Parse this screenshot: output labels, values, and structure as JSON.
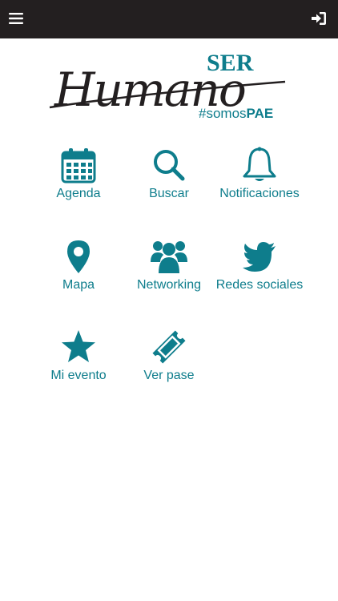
{
  "colors": {
    "topbar": "#231f20",
    "accent": "#0e7d8c",
    "logo_dark": "#231f20"
  },
  "header": {
    "menu_icon": "hamburger-icon",
    "login_icon": "sign-in-icon"
  },
  "logo": {
    "top_word": "SER",
    "script_word": "Humano",
    "hashtag_prefix": "#somos",
    "hashtag_suffix": "PAE"
  },
  "menu": {
    "items": [
      {
        "label": "Agenda",
        "icon": "calendar-icon"
      },
      {
        "label": "Buscar",
        "icon": "search-icon"
      },
      {
        "label": "Notificaciones",
        "icon": "bell-icon"
      },
      {
        "label": "Mapa",
        "icon": "map-marker-icon"
      },
      {
        "label": "Networking",
        "icon": "users-icon"
      },
      {
        "label": "Redes sociales",
        "icon": "twitter-icon"
      },
      {
        "label": "Mi evento",
        "icon": "star-icon"
      },
      {
        "label": "Ver pase",
        "icon": "ticket-icon"
      }
    ]
  }
}
